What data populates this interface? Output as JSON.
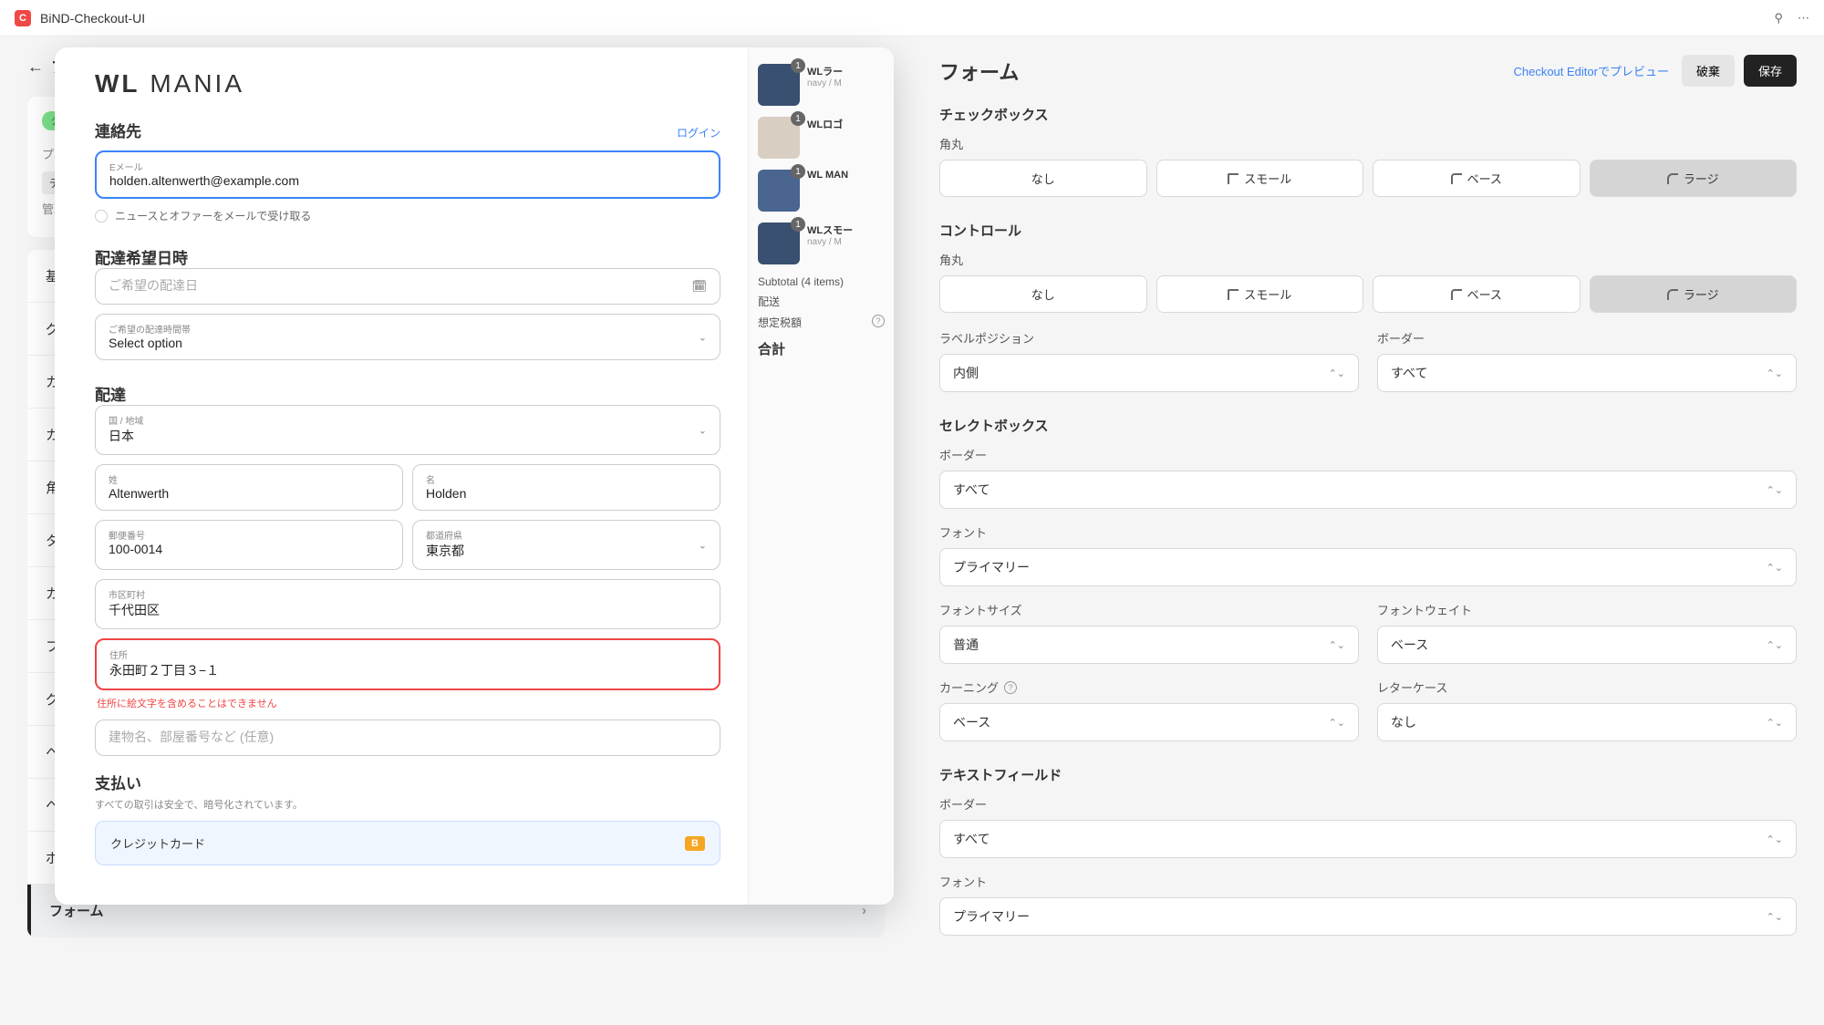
{
  "titlebar": {
    "app": "BiND-Checkout-UI"
  },
  "header": {
    "back": "プ",
    "discard": "破棄",
    "save": "保存"
  },
  "leftSide": {
    "statusBadge": "公開",
    "line1": "プロフ",
    "line2": "デフ",
    "line3": "管理用",
    "nav": [
      "基本デ",
      "グロ",
      "カラ",
      "カラ",
      "角丸",
      "タイ",
      "カスタ",
      "フォ",
      "グロ",
      "ヘッ",
      "ヘッ",
      "ボタン",
      "フォーム"
    ]
  },
  "panel": {
    "title": "フォーム",
    "previewLink": "Checkout Editorでプレビュー",
    "checkbox": {
      "title": "チェックボックス",
      "sub": "角丸",
      "options": [
        "なし",
        "スモール",
        "ベース",
        "ラージ"
      ],
      "activeIndex": 3
    },
    "control": {
      "title": "コントロール",
      "sub": "角丸",
      "options": [
        "なし",
        "スモール",
        "ベース",
        "ラージ"
      ],
      "activeIndex": 3
    },
    "labelPos": {
      "label": "ラベルポジション",
      "value": "内側"
    },
    "border1": {
      "label": "ボーダー",
      "value": "すべて"
    },
    "selectbox": {
      "title": "セレクトボックス"
    },
    "sbBorder": {
      "label": "ボーダー",
      "value": "すべて"
    },
    "sbFont": {
      "label": "フォント",
      "value": "プライマリー"
    },
    "sbFontSize": {
      "label": "フォントサイズ",
      "value": "普通"
    },
    "sbFontWeight": {
      "label": "フォントウェイト",
      "value": "ベース"
    },
    "sbKerning": {
      "label": "カーニング",
      "value": "ベース"
    },
    "sbLetterCase": {
      "label": "レターケース",
      "value": "なし"
    },
    "textfield": {
      "title": "テキストフィールド"
    },
    "tfBorder": {
      "label": "ボーダー",
      "value": "すべて"
    },
    "tfFont": {
      "label": "フォント",
      "value": "プライマリー"
    }
  },
  "preview": {
    "brandBold": "WL",
    "brandThin": "MANIA",
    "contact": {
      "title": "連絡先",
      "login": "ログイン",
      "emailLabel": "Eメール",
      "emailValue": "holden.altenwerth@example.com",
      "newsletter": "ニュースとオファーをメールで受け取る"
    },
    "delivTime": {
      "title": "配達希望日時",
      "datePlaceholder": "ご希望の配達日",
      "timeLabel": "ご希望の配達時間帯",
      "timeValue": "Select option"
    },
    "shipping": {
      "title": "配達",
      "countryLabel": "国 / 地域",
      "countryValue": "日本",
      "lastLabel": "姓",
      "lastValue": "Altenwerth",
      "firstLabel": "名",
      "firstValue": "Holden",
      "zipLabel": "郵便番号",
      "zipValue": "100-0014",
      "prefLabel": "都道府県",
      "prefValue": "東京都",
      "cityLabel": "市区町村",
      "cityValue": "千代田区",
      "addrLabel": "住所",
      "addrValue": "永田町２丁目３−１",
      "addrError": "住所に絵文字を含めることはできません",
      "bldgPlaceholder": "建物名、部屋番号など (任意)"
    },
    "payment": {
      "title": "支払い",
      "note": "すべての取引は安全で、暗号化されています。",
      "option": "クレジットカード",
      "badge": "B"
    },
    "cart": {
      "items": [
        {
          "name": "WLラー",
          "variant": "navy / M",
          "qty": "1"
        },
        {
          "name": "WLロゴ",
          "variant": "",
          "qty": "1"
        },
        {
          "name": "WL MAN",
          "variant": "",
          "qty": "1"
        },
        {
          "name": "WLスモー",
          "variant": "navy / M",
          "qty": "1"
        }
      ],
      "subtotalLabel": "Subtotal (4 items)",
      "shippingLabel": "配送",
      "taxLabel": "想定税額",
      "totalLabel": "合計"
    }
  }
}
